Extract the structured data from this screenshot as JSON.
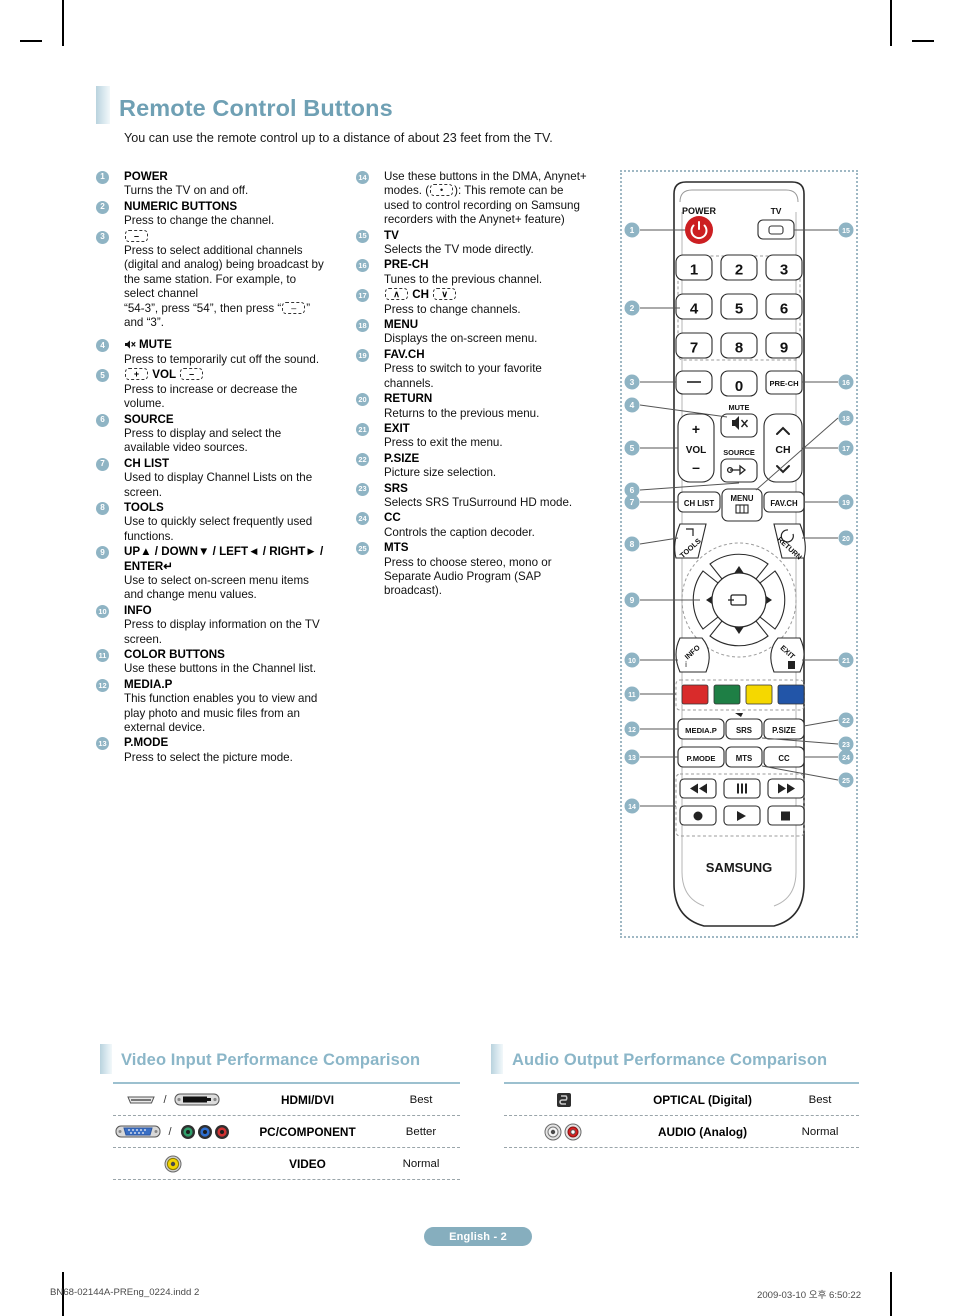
{
  "page": {
    "title": "Remote Control Buttons",
    "intro": "You can use the remote control up to a distance of about 23 feet from the TV.",
    "badge": "English - 2",
    "footer_left": "BN68-02144A-PREng_0224.indd   2",
    "footer_right": "2009-03-10   오후 6:50:22",
    "accent": "#7fa9bb",
    "bullet_color": "#8fb4c4",
    "power_red": "#cc1f22"
  },
  "left_column": [
    {
      "n": "1",
      "title": "POWER",
      "body": "Turns the TV on and off."
    },
    {
      "n": "2",
      "title": "NUMERIC BUTTONS",
      "body": "Press to change the channel."
    },
    {
      "n": "3",
      "title": "",
      "title_icon": "dash-key",
      "body": "Press to select additional channels (digital and analog) being broadcast by the same station. For example, to select channel",
      "body2_pre": "“54-3”, press “54”, then press “",
      "body2_key": "–",
      "body2_post": "” and “3”."
    },
    {
      "n": "4",
      "title": "MUTE",
      "title_icon": "mute-icon",
      "body": "Press to temporarily cut off the sound."
    },
    {
      "n": "5",
      "title": "VOL",
      "title_icon": "vol-keys",
      "body": "Press to increase or decrease the volume."
    },
    {
      "n": "6",
      "title": "SOURCE",
      "body": "Press to display and select the available video sources."
    },
    {
      "n": "7",
      "title": "CH LIST",
      "body": "Used to display Channel Lists on the screen."
    },
    {
      "n": "8",
      "title": "TOOLS",
      "body": "Use to quickly select frequently used functions."
    },
    {
      "n": "9",
      "title": "UP▲ / DOWN▼ / LEFT◄ / RIGHT► / ENTER↵",
      "body": "Use to select on-screen menu items and change menu values."
    },
    {
      "n": "10",
      "title": "INFO",
      "body": "Press to display information on the TV screen."
    },
    {
      "n": "11",
      "title": "COLOR BUTTONS",
      "body": "Use these buttons in the Channel list."
    },
    {
      "n": "12",
      "title": "MEDIA.P",
      "body": "This function enables you to view and play photo and music files from an external device."
    },
    {
      "n": "13",
      "title": "P.MODE",
      "body": "Press to select the picture mode."
    }
  ],
  "mid_column": [
    {
      "n": "14",
      "title": "",
      "body_pre": "Use these buttons in the DMA, Anynet+ modes. (",
      "body_key": "•",
      "body_post": "): This remote can be used to control recording on Samsung recorders with the Anynet+ feature)"
    },
    {
      "n": "15",
      "title": "TV",
      "body": "Selects the TV mode directly."
    },
    {
      "n": "16",
      "title": "PRE-CH",
      "body": "Tunes to the previous channel."
    },
    {
      "n": "17",
      "title": "CH",
      "title_icon": "ch-keys",
      "body": "Press to change channels."
    },
    {
      "n": "18",
      "title": "MENU",
      "body": "Displays the on-screen menu."
    },
    {
      "n": "19",
      "title": "FAV.CH",
      "body": "Press to switch to your favorite channels."
    },
    {
      "n": "20",
      "title": "RETURN",
      "body": "Returns to the previous menu."
    },
    {
      "n": "21",
      "title": "EXIT",
      "body": "Press to exit the menu."
    },
    {
      "n": "22",
      "title": "P.SIZE",
      "body": "Picture size selection."
    },
    {
      "n": "23",
      "title": "SRS",
      "body": "Selects SRS TruSurround HD mode."
    },
    {
      "n": "24",
      "title": "CC",
      "body": "Controls the caption decoder."
    },
    {
      "n": "25",
      "title": "MTS",
      "body": "Press to choose stereo, mono or Separate Audio Program (SAP broadcast)."
    }
  ],
  "remote": {
    "brand": "SAMSUNG",
    "power_label": "POWER",
    "tv_label": "TV",
    "numbers": [
      "1",
      "2",
      "3",
      "4",
      "5",
      "6",
      "7",
      "8",
      "9"
    ],
    "zero": "0",
    "dash": "–",
    "prech": "PRE-CH",
    "mute": "MUTE",
    "source": "SOURCE",
    "vol": "VOL",
    "vol_plus": "+",
    "vol_minus": "–",
    "ch": "CH",
    "chlist": "CH LIST",
    "menu": "MENU",
    "favch": "FAV.CH",
    "tools": "TOOLS",
    "return": "RETURN",
    "info": "INFO",
    "exit": "EXIT",
    "mediap": "MEDIA.P",
    "srs": "SRS",
    "psize": "P.SIZE",
    "pmode": "P.MODE",
    "mts": "MTS",
    "cc": "CC",
    "color_buttons": [
      "#d92b2b",
      "#1e7f45",
      "#f5d800",
      "#2255a8"
    ],
    "transport": [
      "◀◀",
      "❙❙❙",
      "▶▶",
      "●",
      "▶",
      "■"
    ],
    "callouts_left": [
      "1",
      "2",
      "3",
      "4",
      "5",
      "6",
      "7",
      "8",
      "9",
      "10",
      "11",
      "12",
      "13",
      "14"
    ],
    "callouts_right": [
      "15",
      "16",
      "17",
      "18",
      "19",
      "20",
      "21",
      "22",
      "23",
      "24",
      "25"
    ]
  },
  "video_table": {
    "heading": "Video Input Performance Comparison",
    "rows": [
      {
        "icons": [
          "hdmi-connector-icon",
          "dvi-connector-icon"
        ],
        "sep": "/",
        "name": "HDMI/DVI",
        "rank": "Best"
      },
      {
        "icons": [
          "vga-connector-icon",
          "component-jacks-icon"
        ],
        "sep": "/",
        "name": "PC/COMPONENT",
        "rank": "Better"
      },
      {
        "icons": [
          "composite-jack-icon"
        ],
        "sep": "",
        "name": "VIDEO",
        "rank": "Normal"
      }
    ]
  },
  "audio_table": {
    "heading": "Audio Output Performance Comparison",
    "rows": [
      {
        "icons": [
          "optical-toslink-icon"
        ],
        "sep": "",
        "name": "OPTICAL (Digital)",
        "rank": "Best"
      },
      {
        "icons": [
          "audio-rca-jacks-icon"
        ],
        "sep": "",
        "name": "AUDIO (Analog)",
        "rank": "Normal"
      }
    ]
  }
}
